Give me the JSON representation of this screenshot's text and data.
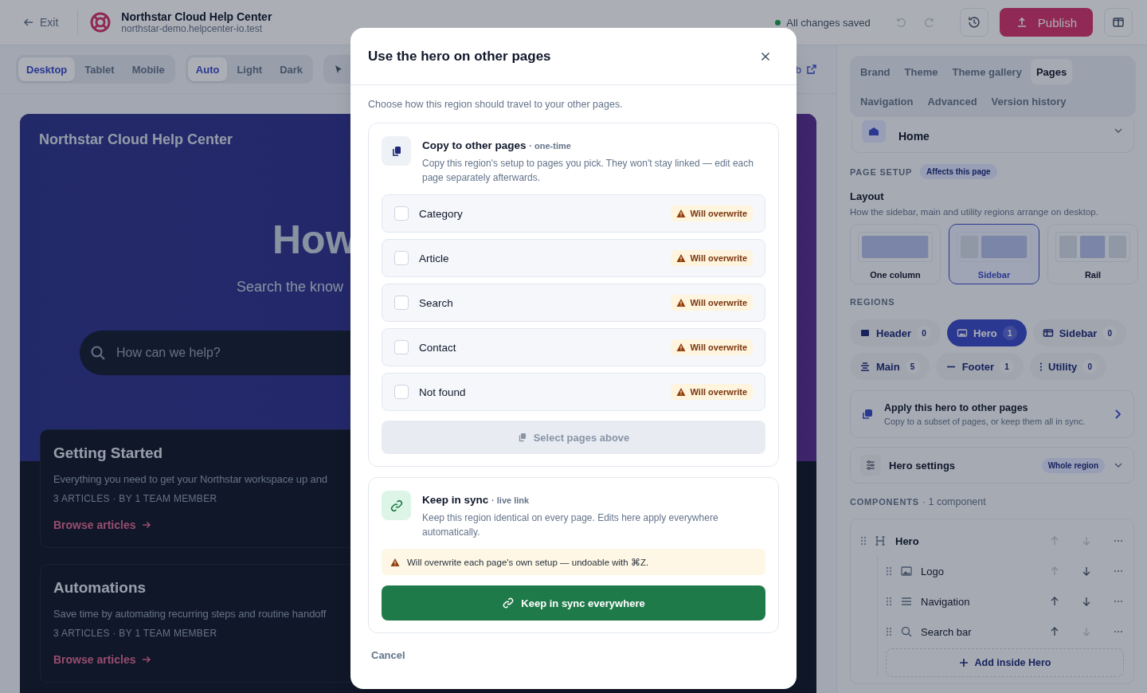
{
  "topbar": {
    "exit": "Exit",
    "site_title": "Northstar Cloud Help Center",
    "site_domain": "northstar-demo.helpcenter-io.test",
    "save_status": "All changes saved",
    "undo_disabled": true,
    "redo_disabled": true,
    "publish": "Publish"
  },
  "toolbar": {
    "devices": [
      {
        "label": "Desktop",
        "selected": true
      },
      {
        "label": "Tablet",
        "selected": false
      },
      {
        "label": "Mobile",
        "selected": false
      }
    ],
    "modes": [
      {
        "label": "Auto",
        "selected": true
      },
      {
        "label": "Light",
        "selected": false
      },
      {
        "label": "Dark",
        "selected": false
      }
    ],
    "live_link": "b"
  },
  "preview": {
    "site_title": "Northstar Cloud Help Center",
    "heading": "How",
    "subtitle": "Search the know",
    "search_placeholder": "How can we help?",
    "cards": [
      {
        "title": "Getting Started",
        "description": "Everything you need to get your Northstar workspace up and",
        "meta": "3 ARTICLES · BY 1 TEAM MEMBER",
        "link": "Browse articles"
      },
      {
        "title": "Automations",
        "description": "Save time by automating recurring steps and routine handoff",
        "meta": "3 ARTICLES · BY 1 TEAM MEMBER",
        "link": "Browse articles"
      }
    ]
  },
  "panel": {
    "tabs": [
      {
        "label": "Brand",
        "selected": false
      },
      {
        "label": "Theme",
        "selected": false
      },
      {
        "label": "Theme gallery",
        "selected": false
      },
      {
        "label": "Pages",
        "selected": true
      },
      {
        "label": "Navigation",
        "selected": false
      },
      {
        "label": "Advanced",
        "selected": false
      },
      {
        "label": "Version history",
        "selected": false
      }
    ],
    "page": "Home",
    "page_setup": {
      "label": "PAGE SETUP",
      "badge": "Affects this page"
    },
    "layout": {
      "title": "Layout",
      "description": "How the sidebar, main and utility regions arrange on desktop.",
      "options": [
        {
          "label": "One column",
          "kind": "one",
          "selected": false
        },
        {
          "label": "Sidebar",
          "kind": "sidebar",
          "selected": true
        },
        {
          "label": "Rail",
          "kind": "rail",
          "selected": false
        }
      ]
    },
    "regions_label": "REGIONS",
    "regions": [
      {
        "label": "Header",
        "count": "0",
        "kind": "header",
        "selected": false
      },
      {
        "label": "Hero",
        "count": "1",
        "kind": "hero",
        "selected": true
      },
      {
        "label": "Sidebar",
        "count": "0",
        "kind": "sidebar",
        "selected": false
      },
      {
        "label": "Main",
        "count": "5",
        "kind": "main",
        "selected": false
      },
      {
        "label": "Footer",
        "count": "1",
        "kind": "footer",
        "selected": false
      },
      {
        "label": "Utility",
        "count": "0",
        "kind": "utility",
        "selected": false
      }
    ],
    "apply": {
      "title": "Apply this hero to other pages",
      "description": "Copy to a subset of pages, or keep them all in sync."
    },
    "hero_settings": {
      "title": "Hero settings",
      "badge": "Whole region"
    },
    "components": {
      "label": "COMPONENTS",
      "count": "· 1 component",
      "tree": [
        {
          "name": "Hero",
          "kind": "heading",
          "can_move_up": false,
          "can_move_down": false,
          "children": [
            {
              "name": "Logo",
              "kind": "image",
              "can_move_up": false,
              "can_move_down": true
            },
            {
              "name": "Navigation",
              "kind": "menu",
              "can_move_up": true,
              "can_move_down": true
            },
            {
              "name": "Search bar",
              "kind": "search",
              "can_move_up": true,
              "can_move_down": false
            }
          ]
        }
      ],
      "add": "Add inside Hero"
    }
  },
  "dialog": {
    "title": "Use the hero on other pages",
    "intro": "Choose how this region should travel to your other pages.",
    "copy": {
      "title": "Copy to other pages",
      "tag": "· one-time",
      "description": "Copy this region's setup to pages you pick. They won't stay linked — edit each page separately afterwards.",
      "pages": [
        {
          "label": "Category",
          "checked": false,
          "warning": "Will overwrite"
        },
        {
          "label": "Article",
          "checked": false,
          "warning": "Will overwrite"
        },
        {
          "label": "Search",
          "checked": false,
          "warning": "Will overwrite"
        },
        {
          "label": "Contact",
          "checked": false,
          "warning": "Will overwrite"
        },
        {
          "label": "Not found",
          "checked": false,
          "warning": "Will overwrite"
        }
      ],
      "button": "Select pages above",
      "button_disabled": true
    },
    "sync": {
      "title": "Keep in sync",
      "tag": "· live link",
      "description": "Keep this region identical on every page. Edits here apply everywhere automatically.",
      "warning": "Will overwrite each page's own setup — undoable with ⌘Z.",
      "button": "Keep in sync everywhere"
    },
    "cancel": "Cancel"
  }
}
